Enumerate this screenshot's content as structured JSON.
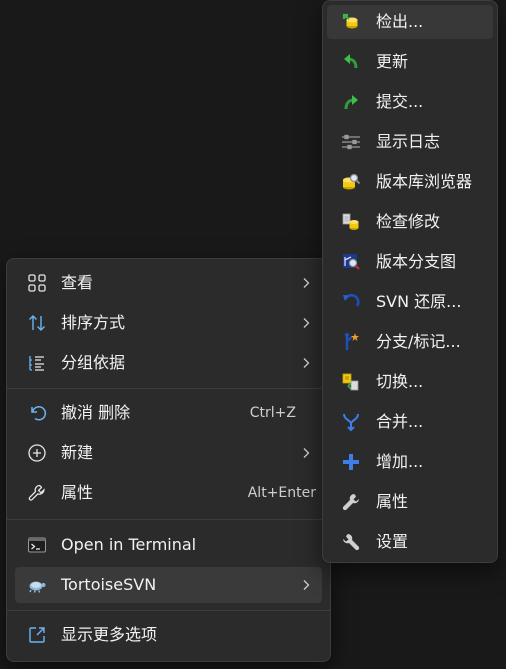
{
  "main_menu": {
    "items": [
      {
        "label": "查看",
        "icon": "grid-icon"
      },
      {
        "label": "排序方式",
        "icon": "sort-icon"
      },
      {
        "label": "分组依据",
        "icon": "group-list-icon"
      },
      {
        "label": "撤消 删除",
        "shortcut": "Ctrl+Z",
        "icon": "undo-icon"
      },
      {
        "label": "新建",
        "icon": "plus-circle-icon"
      },
      {
        "label": "属性",
        "shortcut": "Alt+Enter",
        "icon": "wrench-icon"
      },
      {
        "label": "Open in Terminal",
        "icon": "terminal-icon"
      },
      {
        "label": "TortoiseSVN",
        "icon": "tortoise-icon"
      },
      {
        "label": "显示更多选项",
        "icon": "expand-icon"
      }
    ]
  },
  "submenu": {
    "items": [
      {
        "label": "检出...",
        "icon": "checkout-icon"
      },
      {
        "label": "更新",
        "icon": "update-icon"
      },
      {
        "label": "提交...",
        "icon": "commit-icon"
      },
      {
        "label": "显示日志",
        "icon": "log-icon"
      },
      {
        "label": "版本库浏览器",
        "icon": "repo-browser-icon"
      },
      {
        "label": "检查修改",
        "icon": "check-modifications-icon"
      },
      {
        "label": "版本分支图",
        "icon": "revision-graph-icon"
      },
      {
        "label": "SVN 还原...",
        "icon": "revert-icon"
      },
      {
        "label": "分支/标记...",
        "icon": "branch-tag-icon"
      },
      {
        "label": "切换...",
        "icon": "switch-icon"
      },
      {
        "label": "合并...",
        "icon": "merge-icon"
      },
      {
        "label": "增加...",
        "icon": "add-icon"
      },
      {
        "label": "属性",
        "icon": "properties-wrench-icon"
      },
      {
        "label": "设置",
        "icon": "settings-wrench-icon"
      }
    ]
  },
  "colors": {
    "background": "#191919",
    "menu_bg": "#2b2b2b",
    "highlight": "#3a3a3a",
    "text": "#f2f2f2",
    "accent_blue": "#5aa9f0"
  }
}
